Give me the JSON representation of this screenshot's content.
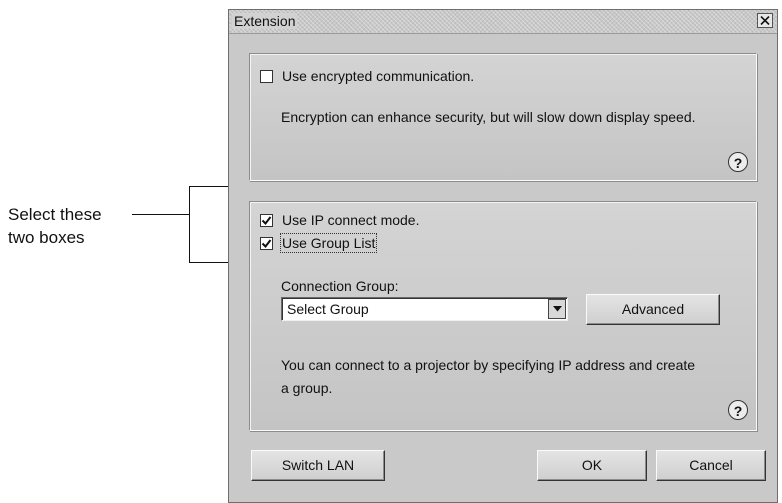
{
  "callout": {
    "text": "Select these\ntwo boxes"
  },
  "window": {
    "title": "Extension",
    "close_icon": "close-icon"
  },
  "encryption_panel": {
    "checkbox_label": "Use encrypted communication.",
    "checked": false,
    "description": "Encryption can enhance security, but will slow down display speed.",
    "help_glyph": "?"
  },
  "connection_panel": {
    "ip_mode_label": "Use IP connect mode.",
    "ip_mode_checked": true,
    "group_list_label": "Use Group List",
    "group_list_checked": true,
    "group_label": "Connection Group:",
    "group_select_value": "Select Group",
    "advanced_label": "Advanced",
    "description": "You can connect to a projector by specifying IP address and create a group.",
    "help_glyph": "?"
  },
  "footer": {
    "switch_lan_label": "Switch LAN",
    "ok_label": "OK",
    "cancel_label": "Cancel"
  }
}
